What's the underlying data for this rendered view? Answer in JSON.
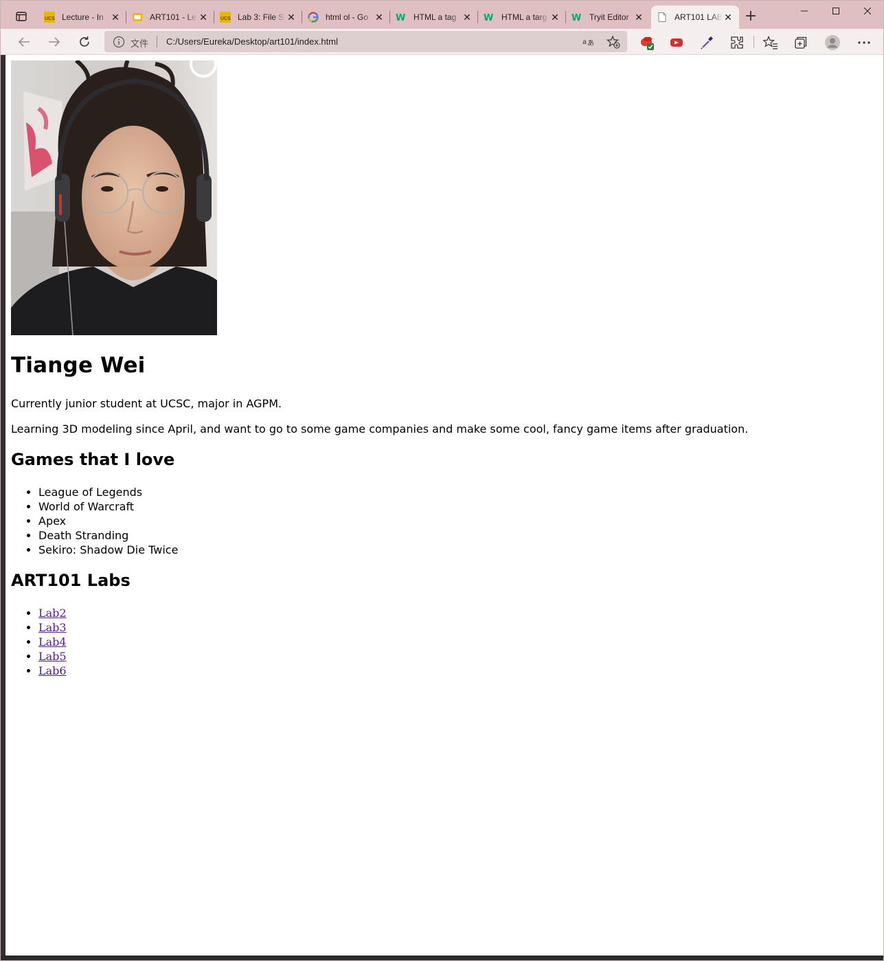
{
  "browser": {
    "tabs": [
      {
        "title": "Lecture - In",
        "favicon": "ucsc-icon"
      },
      {
        "title": "ART101 - Le",
        "favicon": "slides-icon"
      },
      {
        "title": "Lab 3: File S",
        "favicon": "ucsc-icon"
      },
      {
        "title": "html ol - Go",
        "favicon": "google-icon"
      },
      {
        "title": "HTML a tag",
        "favicon": "w3schools-icon"
      },
      {
        "title": "HTML a targ",
        "favicon": "w3schools-icon"
      },
      {
        "title": "Tryit Editor",
        "favicon": "w3schools-icon"
      },
      {
        "title": "ART101 LAB",
        "favicon": "page-icon"
      }
    ],
    "new_tab_label": "+",
    "address": {
      "info_label": "文件",
      "url": "C:/Users/Eureka/Desktop/art101/index.html"
    },
    "colors": {
      "tabstrip": "#dfbfbf",
      "toolbar": "#f5eeee",
      "omnibox": "#ddcfcf"
    }
  },
  "page": {
    "name": "Tiange Wei",
    "bio_1": "Currently junior student at UCSC, major in AGPM.",
    "bio_2": "Learning 3D modeling since April, and want to go to some game companies and make some cool, fancy game items after graduation.",
    "games_heading": "Games that I love",
    "games": [
      "League of Legends",
      "World of Warcraft",
      "Apex",
      "Death Stranding",
      "Sekiro: Shadow Die Twice"
    ],
    "labs_heading": "ART101 Labs",
    "labs": [
      "Lab2",
      "Lab3",
      "Lab4",
      "Lab5",
      "Lab6"
    ],
    "link_color": "#551a8b"
  }
}
